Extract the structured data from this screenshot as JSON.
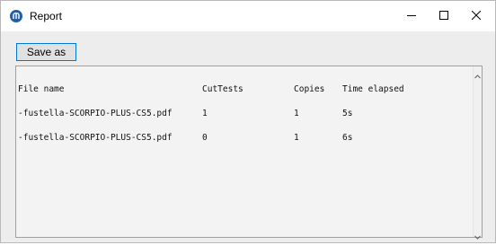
{
  "window": {
    "title": "Report",
    "controls": {
      "minimize": "minimize",
      "maximize": "maximize",
      "close": "close"
    }
  },
  "toolbar": {
    "save_label": "Save as"
  },
  "report": {
    "columns": [
      "File name",
      "CutTests",
      "Copies",
      "Time elapsed"
    ],
    "rows": [
      {
        "file": "-fustella-SCORPIO-PLUS-CS5.pdf",
        "cuttests": "1",
        "copies": "1",
        "time": "5s"
      },
      {
        "file": "-fustella-SCORPIO-PLUS-CS5.pdf",
        "cuttests": "0",
        "copies": "1",
        "time": "6s"
      }
    ]
  },
  "colors": {
    "accent": "#0078d7",
    "icon_bg": "#1f5fa8"
  },
  "icons": {
    "app": "app-logo-icon",
    "minimize": "minimize-icon",
    "maximize": "maximize-icon",
    "close": "close-icon"
  }
}
